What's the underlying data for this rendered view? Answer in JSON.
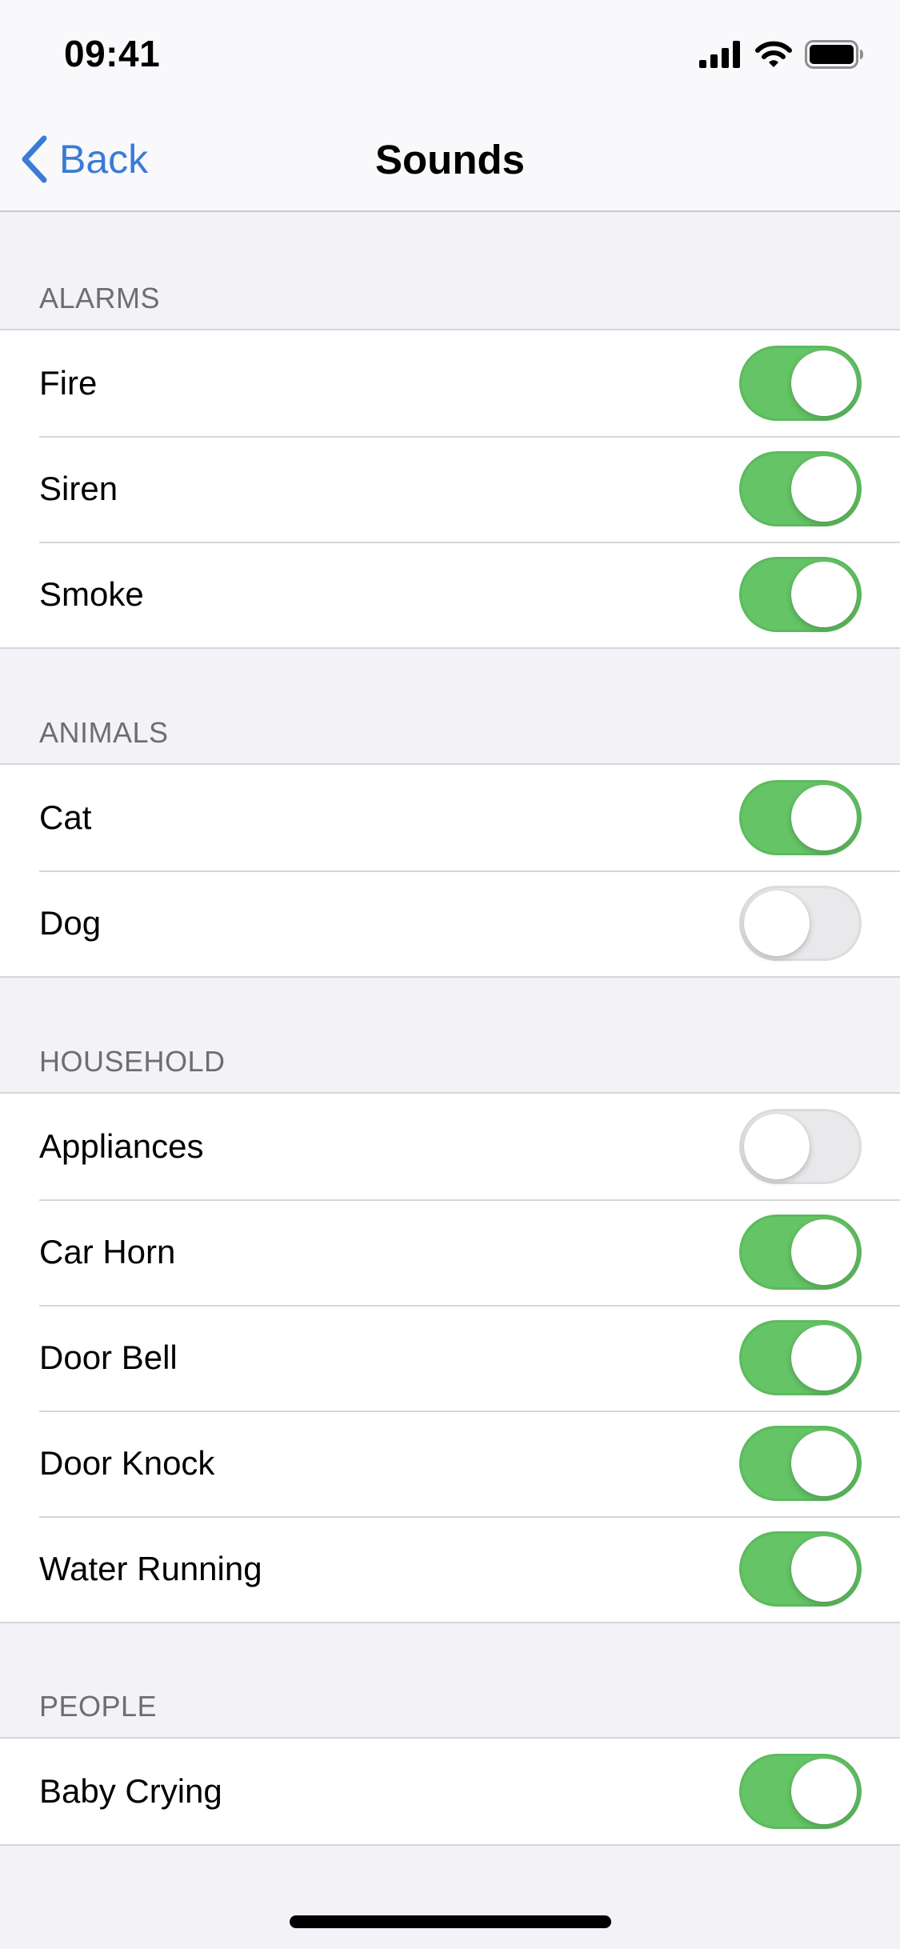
{
  "status_bar": {
    "time": "09:41"
  },
  "nav": {
    "back_label": "Back",
    "title": "Sounds"
  },
  "sections": {
    "alarms": {
      "header": "ALARMS",
      "items": [
        {
          "label": "Fire",
          "on": true
        },
        {
          "label": "Siren",
          "on": true
        },
        {
          "label": "Smoke",
          "on": true
        }
      ]
    },
    "animals": {
      "header": "ANIMALS",
      "items": [
        {
          "label": "Cat",
          "on": true
        },
        {
          "label": "Dog",
          "on": false
        }
      ]
    },
    "household": {
      "header": "HOUSEHOLD",
      "items": [
        {
          "label": "Appliances",
          "on": false
        },
        {
          "label": "Car Horn",
          "on": true
        },
        {
          "label": "Door Bell",
          "on": true
        },
        {
          "label": "Door Knock",
          "on": true
        },
        {
          "label": "Water Running",
          "on": true
        }
      ]
    },
    "people": {
      "header": "PEOPLE",
      "items": [
        {
          "label": "Baby Crying",
          "on": true
        }
      ]
    }
  },
  "colors": {
    "accent": "#3a7bd5",
    "toggle_on": "#65c466",
    "toggle_off": "#e9e9eb",
    "background": "#f2f2f7"
  },
  "icons": {
    "back": "chevron-left-icon",
    "signal": "cellular-signal-icon",
    "wifi": "wifi-icon",
    "battery": "battery-icon"
  }
}
